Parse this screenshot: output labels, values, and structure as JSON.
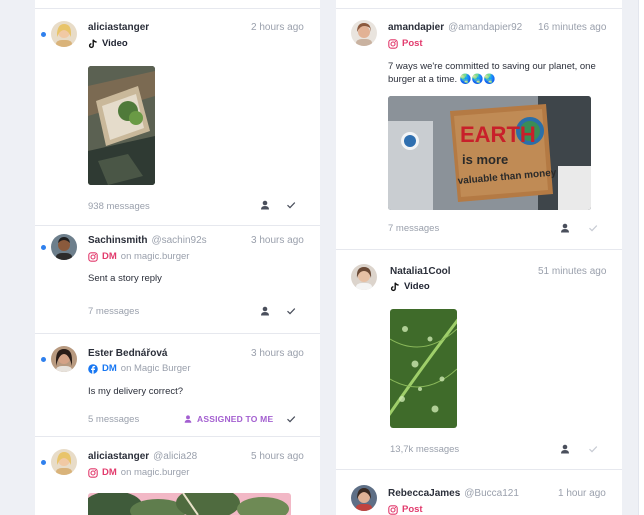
{
  "left_column": {
    "cards": [
      {
        "username": "aliciastanger",
        "handle": "",
        "time": "2 hours ago",
        "channel": "Video",
        "on_text": "",
        "messages": "938 messages"
      },
      {
        "username": "Sachinsmith",
        "handle": "@sachin92s",
        "time": "3 hours ago",
        "channel": "DM",
        "on_text": "on magic.burger",
        "text": "Sent a story reply",
        "messages": "7 messages"
      },
      {
        "username": "Ester Bednářová",
        "handle": "",
        "time": "3 hours ago",
        "channel": "DM",
        "on_text": "on Magic Burger",
        "text": "Is my delivery correct?",
        "messages": "5 messages",
        "assigned": "ASSIGNED TO ME"
      },
      {
        "username": "aliciastanger",
        "handle": "@alicia28",
        "time": "5 hours ago",
        "channel": "DM",
        "on_text": "on magic.burger"
      }
    ]
  },
  "right_column": {
    "cards": [
      {
        "username": "amandapier",
        "handle": "@amandapier92",
        "time": "16 minutes ago",
        "channel": "Post",
        "text": "7 ways we're committed to saving our planet, one burger at a time. 🌏🌏🌏",
        "image_sign_line1": "EARTH",
        "image_sign_line2": "is more",
        "image_sign_line3": "valuable than money",
        "messages": "7 messages"
      },
      {
        "username": "Natalia1Cool",
        "handle": "",
        "time": "51 minutes ago",
        "channel": "Video",
        "messages": "13,7k messages"
      },
      {
        "username": "RebeccaJames",
        "handle": "@Bucca121",
        "time": "1 hour ago",
        "channel": "Post"
      }
    ]
  },
  "colors": {
    "accent_blue": "#2f80ed",
    "instagram_pink": "#e23b6d",
    "assigned_purple": "#a35fd0",
    "facebook_blue": "#1877f2"
  },
  "icons": [
    "tiktok-icon",
    "instagram-icon",
    "facebook-icon",
    "person-icon",
    "check-icon"
  ]
}
